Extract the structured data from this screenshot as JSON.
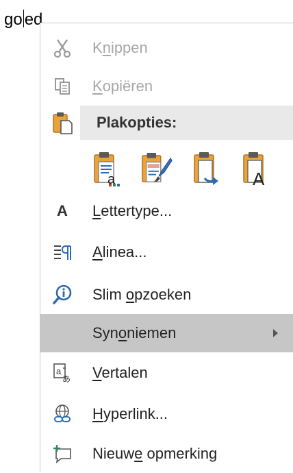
{
  "document": {
    "text_before": "go",
    "text_after": "ed"
  },
  "context_menu": {
    "items": [
      {
        "label": "Knippen",
        "underline_index": 1,
        "icon": "scissors-icon",
        "disabled": true
      },
      {
        "label": "Kopiëren",
        "underline_index": 0,
        "icon": "copy-icon",
        "disabled": true
      },
      {
        "label": "Lettertype...",
        "underline_index": 0,
        "icon": "font-icon",
        "icon_glyph": "A"
      },
      {
        "label": "Alinea...",
        "underline_index": 0,
        "icon": "paragraph-icon"
      },
      {
        "label": "Slim opzoeken",
        "underline_index": 5,
        "icon": "smart-lookup-icon"
      },
      {
        "label": "Synoniemen",
        "underline_index": 3,
        "icon": "",
        "highlighted": true,
        "has_submenu": true
      },
      {
        "label": "Vertalen",
        "underline_index": 0,
        "icon": "translate-icon"
      },
      {
        "label": "Hyperlink...",
        "underline_index": 0,
        "icon": "hyperlink-icon"
      },
      {
        "label": "Nieuwe opmerking",
        "underline_index": 5,
        "icon": "new-comment-icon"
      }
    ],
    "paste_options": {
      "header": "Plakopties:",
      "icon": "paste-icon",
      "buttons": [
        {
          "name": "keep-source-formatting-icon",
          "badge": "a"
        },
        {
          "name": "merge-formatting-icon"
        },
        {
          "name": "picture-paste-icon"
        },
        {
          "name": "keep-text-only-icon",
          "badge": "A"
        }
      ]
    }
  },
  "colors": {
    "highlight": "#c6c6c6",
    "disabled_text": "#a6a6a6",
    "paste_header_bg": "#e9e9e9",
    "clipboard_orange": "#e8a33c",
    "accent_blue": "#2b6cb0"
  }
}
